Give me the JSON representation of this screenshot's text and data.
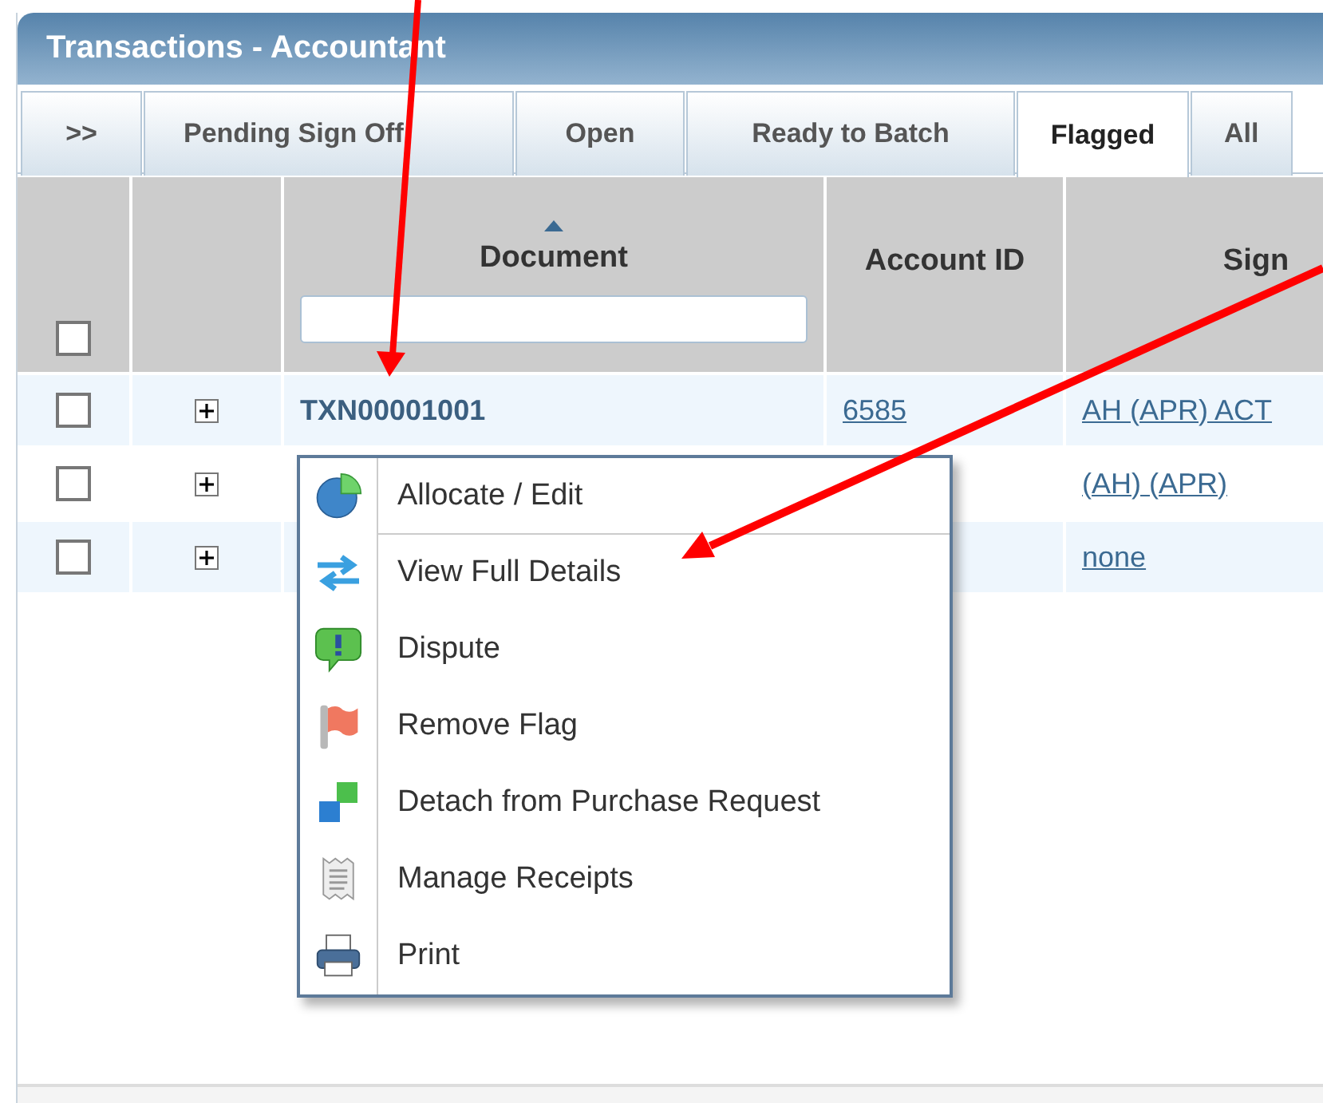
{
  "window": {
    "title": "Transactions - Accountant"
  },
  "tabs": [
    {
      "label": ">>",
      "selected": false
    },
    {
      "label": "Pending Sign Off",
      "selected": false
    },
    {
      "label": "Open",
      "selected": false
    },
    {
      "label": "Ready to Batch",
      "selected": false
    },
    {
      "label": "Flagged",
      "selected": true
    },
    {
      "label": "All",
      "selected": false
    }
  ],
  "table": {
    "header_checkbox": {
      "checked": false
    },
    "columns": [
      {
        "label": "Document",
        "sorted": true,
        "filter": true
      },
      {
        "label": "Account ID",
        "sorted": false,
        "filter": false
      },
      {
        "label": "Sign",
        "sorted": false,
        "filter": false
      }
    ],
    "rows": [
      {
        "checked": false,
        "expanded": false,
        "document": "TXN00001001",
        "account_id": "6585",
        "signer": "AH (APR) ACT"
      },
      {
        "checked": false,
        "expanded": false,
        "signer": "(AH) (APR)"
      },
      {
        "checked": false,
        "expanded": false,
        "signer": "none"
      }
    ]
  },
  "context_menu": {
    "items": [
      {
        "kind": "allocate",
        "label": "Allocate / Edit",
        "separator_after": true
      },
      {
        "kind": "details",
        "label": "View Full Details",
        "separator_after": false
      },
      {
        "kind": "dispute",
        "label": "Dispute",
        "separator_after": false
      },
      {
        "kind": "flag",
        "label": "Remove Flag",
        "separator_after": false
      },
      {
        "kind": "detach",
        "label": "Detach from Purchase Request",
        "separator_after": false
      },
      {
        "kind": "receipts",
        "label": "Manage Receipts",
        "separator_after": false
      },
      {
        "kind": "print",
        "label": "Print",
        "separator_after": false
      }
    ]
  }
}
